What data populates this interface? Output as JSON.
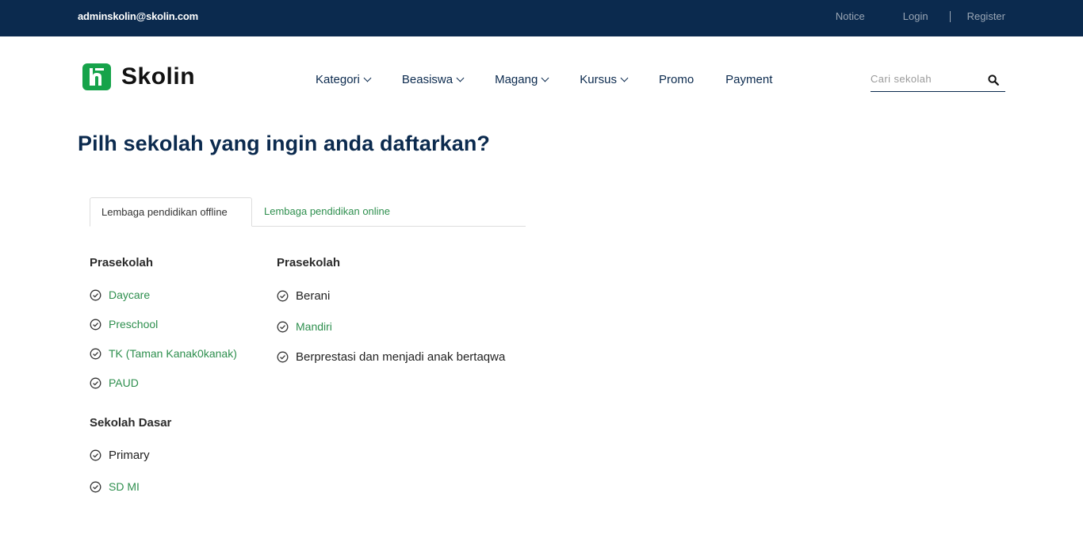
{
  "topbar": {
    "email": "adminskolin@skolin.com",
    "notice": "Notice",
    "login": "Login",
    "register": "Register"
  },
  "brand": {
    "name": "Skolin",
    "color": "#16a34a"
  },
  "nav": {
    "items": [
      {
        "label": "Kategori",
        "dropdown": true
      },
      {
        "label": "Beasiswa",
        "dropdown": true
      },
      {
        "label": "Magang",
        "dropdown": true
      },
      {
        "label": "Kursus",
        "dropdown": true
      },
      {
        "label": "Promo",
        "dropdown": false
      },
      {
        "label": "Payment",
        "dropdown": false
      }
    ]
  },
  "search": {
    "placeholder": "Cari sekolah",
    "icon": "search-icon"
  },
  "page": {
    "title": "Pilh sekolah yang ingin anda daftarkan?"
  },
  "tabs": [
    {
      "label": "Lembaga pendidikan offline",
      "active": true
    },
    {
      "label": "Lembaga pendidikan online",
      "active": false
    }
  ],
  "left_column": {
    "groups": [
      {
        "heading": "Prasekolah",
        "items": [
          "Daycare",
          "Preschool",
          "TK (Taman Kanak0kanak)",
          "PAUD"
        ]
      },
      {
        "heading": "Sekolah Dasar",
        "items": [
          "Primary",
          "SD MI"
        ]
      }
    ]
  },
  "right_column": {
    "heading": "Prasekolah",
    "items": [
      "Berani",
      "Mandiri",
      "Berprestasi dan menjadi anak bertaqwa"
    ]
  },
  "colors": {
    "navy": "#0b2a4e",
    "link_green": "#2e8f4e"
  }
}
